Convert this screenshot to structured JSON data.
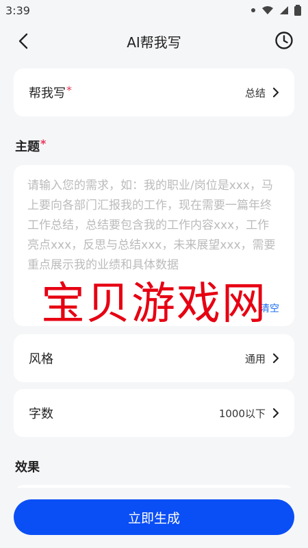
{
  "status_bar": {
    "time": "3:39"
  },
  "nav": {
    "title": "AI帮我写"
  },
  "type_row": {
    "label": "帮我写",
    "required_mark": "*",
    "value": "总结"
  },
  "topic": {
    "label": "主题",
    "required_mark": "*",
    "value": "",
    "placeholder": "请输入您的需求，如：我的职业/岗位是xxx，马上要向各部门汇报我的工作，现在需要一篇年终工作总结，总结要包含我的工作内容xxx，工作亮点xxx，反思与总结xxx，未来展望xxx，需要重点展示我的业绩和具体数据",
    "clear_label": "清空"
  },
  "style_row": {
    "label": "风格",
    "value": "通用"
  },
  "length_row": {
    "label": "字数",
    "value": "1000以下"
  },
  "effect": {
    "label": "效果"
  },
  "watermark": {
    "text": "宝贝游戏网"
  },
  "generate_button": {
    "label": "立即生成"
  },
  "colors": {
    "accent": "#0a4ef5",
    "required": "#e8345a",
    "link": "#1a6cf2",
    "watermark": "#e60012"
  }
}
